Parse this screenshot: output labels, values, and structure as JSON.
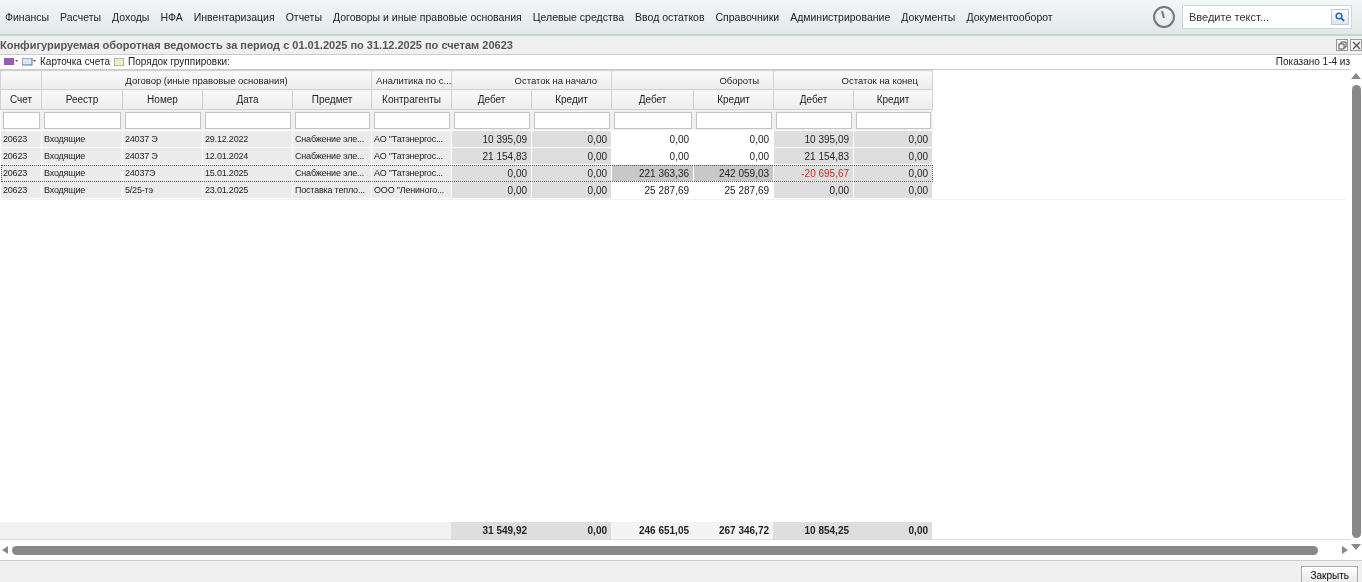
{
  "menu": [
    {
      "label": "Финансы"
    },
    {
      "label": "Расчеты"
    },
    {
      "label": "Доходы"
    },
    {
      "label": "НФА"
    },
    {
      "label": "Инвентаризация"
    },
    {
      "label": "Отчеты"
    },
    {
      "label": "Договоры и иные правовые основания"
    },
    {
      "label": "Целевые средства"
    },
    {
      "label": "Ввод остатков"
    },
    {
      "label": "Справочники"
    },
    {
      "label": "Администрирование"
    },
    {
      "label": "Документы"
    },
    {
      "label": "Документооборот"
    }
  ],
  "search": {
    "placeholder": "Введите текст..."
  },
  "report_title": "Конфигурируемая оборотная ведомость за период с 01.01.2025 по 31.12.2025 по счетам 20623",
  "toolbar": {
    "card_label": "Карточка счета",
    "grouping_label": "Порядок группировки:",
    "shown": "Показано 1-4 из"
  },
  "table": {
    "groups": [
      {
        "label": "Договор (иные правовые основания)"
      },
      {
        "label": "Аналитика по с..."
      },
      {
        "label": "Остаток на начало"
      },
      {
        "label": "Обороты"
      },
      {
        "label": "Остаток на конец"
      }
    ],
    "columns": [
      "Счет",
      "Реестр",
      "Номер",
      "Дата",
      "Предмет",
      "Контрагенты",
      "Дебет",
      "Кредит",
      "Дебет",
      "Кредит",
      "Дебет",
      "Кредит"
    ],
    "rows": [
      {
        "selected": false,
        "cells": [
          "20623",
          "Входящие",
          "24037 Э",
          "29.12.2022",
          "Снабжение эле...",
          "АО \"Татэнергос..."
        ],
        "amounts": [
          {
            "value": "10 395,09",
            "negative": false
          },
          {
            "value": "0,00",
            "negative": false
          },
          {
            "value": "0,00",
            "negative": false
          },
          {
            "value": "0,00",
            "negative": false
          },
          {
            "value": "10 395,09",
            "negative": false
          },
          {
            "value": "0,00",
            "negative": false
          }
        ]
      },
      {
        "selected": false,
        "cells": [
          "20623",
          "Входящие",
          "24037 Э",
          "12.01.2024",
          "Снабжение эле...",
          "АО \"Татэнергос..."
        ],
        "amounts": [
          {
            "value": "21 154,83",
            "negative": false
          },
          {
            "value": "0,00",
            "negative": false
          },
          {
            "value": "0,00",
            "negative": false
          },
          {
            "value": "0,00",
            "negative": false
          },
          {
            "value": "21 154,83",
            "negative": false
          },
          {
            "value": "0,00",
            "negative": false
          }
        ]
      },
      {
        "selected": true,
        "cells": [
          "20623",
          "Входящие",
          "24037Э",
          "15.01.2025",
          "Снабжение эле...",
          "АО \"Татэнергос..."
        ],
        "amounts": [
          {
            "value": "0,00",
            "negative": false
          },
          {
            "value": "0,00",
            "negative": false
          },
          {
            "value": "221 363,36",
            "negative": false
          },
          {
            "value": "242 059,03",
            "negative": false
          },
          {
            "value": "-20 695,67",
            "negative": true
          },
          {
            "value": "0,00",
            "negative": false
          }
        ]
      },
      {
        "selected": false,
        "cells": [
          "20623",
          "Входящие",
          "5/25-тэ",
          "23.01.2025",
          "Поставка тепло...",
          "ООО \"Лениного..."
        ],
        "amounts": [
          {
            "value": "0,00",
            "negative": false
          },
          {
            "value": "0,00",
            "negative": false
          },
          {
            "value": "25 287,69",
            "negative": false
          },
          {
            "value": "25 287,69",
            "negative": false
          },
          {
            "value": "0,00",
            "negative": false
          },
          {
            "value": "0,00",
            "negative": false
          }
        ]
      }
    ],
    "totals": [
      "31 549,92",
      "0,00",
      "246 651,05",
      "267 346,72",
      "10 854,25",
      "0,00"
    ]
  },
  "close_button": "Закрыть"
}
